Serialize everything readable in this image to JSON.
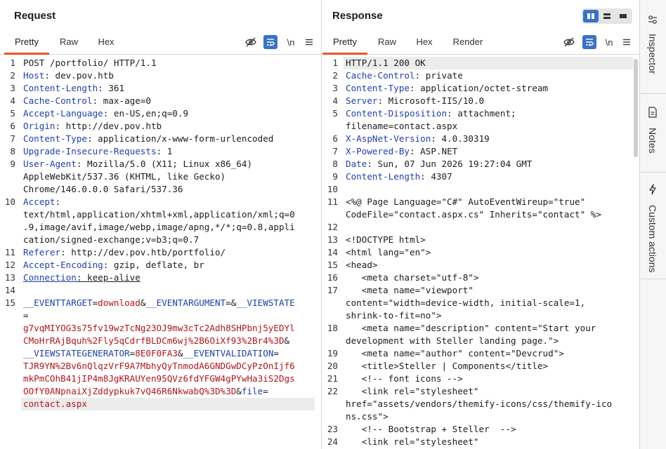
{
  "request": {
    "title": "Request",
    "tabs": [
      "Pretty",
      "Raw",
      "Hex"
    ],
    "active_tab": "Pretty",
    "lines": [
      {
        "n": "1",
        "segs": [
          [
            "t",
            "POST /portfolio/ HTTP/1.1"
          ]
        ]
      },
      {
        "n": "2",
        "segs": [
          [
            "k",
            "Host"
          ],
          [
            "t",
            ": dev.pov.htb"
          ]
        ]
      },
      {
        "n": "3",
        "segs": [
          [
            "k",
            "Content-Length"
          ],
          [
            "t",
            ": 361"
          ]
        ]
      },
      {
        "n": "4",
        "segs": [
          [
            "k",
            "Cache-Control"
          ],
          [
            "t",
            ": max-age=0"
          ]
        ]
      },
      {
        "n": "5",
        "segs": [
          [
            "k",
            "Accept-Language"
          ],
          [
            "t",
            ": en-US,en;q=0.9"
          ]
        ]
      },
      {
        "n": "6",
        "segs": [
          [
            "k",
            "Origin"
          ],
          [
            "t",
            ": http://dev.pov.htb"
          ]
        ]
      },
      {
        "n": "7",
        "segs": [
          [
            "k",
            "Content-Type"
          ],
          [
            "t",
            ": application/x-www-form-urlencoded"
          ]
        ]
      },
      {
        "n": "8",
        "segs": [
          [
            "k",
            "Upgrade-Insecure-Requests"
          ],
          [
            "t",
            ": 1"
          ]
        ]
      },
      {
        "n": "9",
        "segs": [
          [
            "k",
            "User-Agent"
          ],
          [
            "t",
            ": Mozilla/5.0 (X11; Linux x86_64)"
          ]
        ]
      },
      {
        "n": "",
        "segs": [
          [
            "t",
            "AppleWebKit/537.36 (KHTML, like Gecko)"
          ]
        ]
      },
      {
        "n": "",
        "segs": [
          [
            "t",
            "Chrome/146.0.0.0 Safari/537.36"
          ]
        ]
      },
      {
        "n": "10",
        "segs": [
          [
            "k",
            "Accept"
          ],
          [
            "t",
            ":"
          ]
        ]
      },
      {
        "n": "",
        "segs": [
          [
            "t",
            "text/html,application/xhtml+xml,application/xml;q=0"
          ]
        ]
      },
      {
        "n": "",
        "segs": [
          [
            "t",
            ".9,image/avif,image/webp,image/apng,*/*;q=0.8,appli"
          ]
        ]
      },
      {
        "n": "",
        "segs": [
          [
            "t",
            "cation/signed-exchange;v=b3;q=0.7"
          ]
        ]
      },
      {
        "n": "11",
        "segs": [
          [
            "k",
            "Referer"
          ],
          [
            "t",
            ": http://dev.pov.htb/portfolio/"
          ]
        ]
      },
      {
        "n": "12",
        "segs": [
          [
            "k",
            "Accept-Encoding"
          ],
          [
            "t",
            ": gzip, deflate, br"
          ]
        ]
      },
      {
        "n": "13",
        "segs": [
          [
            "k",
            "Connection"
          ],
          [
            "t",
            ": keep-alive"
          ]
        ]
      },
      {
        "n": "14",
        "segs": []
      },
      {
        "n": "15",
        "segs": [
          [
            "p",
            "__EVENTTARGET"
          ],
          [
            "t",
            "="
          ],
          [
            "v",
            "download"
          ],
          [
            "t",
            "&"
          ],
          [
            "p",
            "__EVENTARGUMENT"
          ],
          [
            "t",
            "=&"
          ],
          [
            "p",
            "__VIEWSTATE"
          ]
        ]
      },
      {
        "n": "",
        "segs": [
          [
            "t",
            "="
          ]
        ]
      },
      {
        "n": "",
        "segs": [
          [
            "v",
            "g7vqMIYOG3s75fv19wzTcNg23OJ9mw3cTc2Adh8SHPbnj5yEDYl"
          ]
        ]
      },
      {
        "n": "",
        "segs": [
          [
            "v",
            "CMoHrRAjBquh%2Fly5qCdrfBLDCm6wj%2B6OiXf93%2Br4%3D"
          ],
          [
            "t",
            "&"
          ]
        ]
      },
      {
        "n": "",
        "segs": [
          [
            "p",
            "__VIEWSTATEGENERATOR"
          ],
          [
            "t",
            "="
          ],
          [
            "v",
            "8E0F0FA3"
          ],
          [
            "t",
            "&"
          ],
          [
            "p",
            "__EVENTVALIDATION"
          ],
          [
            "t",
            "="
          ]
        ]
      },
      {
        "n": "",
        "segs": [
          [
            "v",
            "TJR9YN%2Bv6nQlqzVrF9A7MbhyQyTnmodA6GNDGwDCyPzOnIjf6"
          ]
        ]
      },
      {
        "n": "",
        "segs": [
          [
            "v",
            "mkPmCOhB41jIP4m8JgKRAUYen95QVz6fdYFGW4gPYwHa3iS2Dgs"
          ]
        ]
      },
      {
        "n": "",
        "segs": [
          [
            "v",
            "OOfY0ANpnaiXjZddypkuk7vQ46R6NkwabQ%3D%3D"
          ],
          [
            "t",
            "&"
          ],
          [
            "p",
            "file"
          ],
          [
            "t",
            "="
          ]
        ]
      },
      {
        "n": "",
        "segs": [
          [
            "v",
            "contact.aspx"
          ]
        ]
      }
    ]
  },
  "response": {
    "title": "Response",
    "tabs": [
      "Pretty",
      "Raw",
      "Hex",
      "Render"
    ],
    "active_tab": "Pretty",
    "lines": [
      {
        "n": "1",
        "segs": [
          [
            "t",
            "HTTP/1.1 200 OK"
          ]
        ]
      },
      {
        "n": "2",
        "segs": [
          [
            "k",
            "Cache-Control"
          ],
          [
            "t",
            ": private"
          ]
        ]
      },
      {
        "n": "3",
        "segs": [
          [
            "k",
            "Content-Type"
          ],
          [
            "t",
            ": application/octet-stream"
          ]
        ]
      },
      {
        "n": "4",
        "segs": [
          [
            "k",
            "Server"
          ],
          [
            "t",
            ": Microsoft-IIS/10.0"
          ]
        ]
      },
      {
        "n": "5",
        "segs": [
          [
            "k",
            "Content-Disposition"
          ],
          [
            "t",
            ": attachment;"
          ]
        ]
      },
      {
        "n": "",
        "segs": [
          [
            "t",
            "filename=contact.aspx"
          ]
        ]
      },
      {
        "n": "6",
        "segs": [
          [
            "k",
            "X-AspNet-Version"
          ],
          [
            "t",
            ": 4.0.30319"
          ]
        ]
      },
      {
        "n": "7",
        "segs": [
          [
            "k",
            "X-Powered-By"
          ],
          [
            "t",
            ": ASP.NET"
          ]
        ]
      },
      {
        "n": "8",
        "segs": [
          [
            "k",
            "Date"
          ],
          [
            "t",
            ": Sun, 07 Jun 2026 19:27:04 GMT"
          ]
        ]
      },
      {
        "n": "9",
        "segs": [
          [
            "k",
            "Content-Length"
          ],
          [
            "t",
            ": 4307"
          ]
        ]
      },
      {
        "n": "10",
        "segs": []
      },
      {
        "n": "11",
        "segs": [
          [
            "t",
            "<%@ Page Language=\"C#\" AutoEventWireup=\"true\""
          ]
        ]
      },
      {
        "n": "",
        "segs": [
          [
            "t",
            "CodeFile=\"contact.aspx.cs\" Inherits=\"contact\" %>"
          ]
        ]
      },
      {
        "n": "12",
        "segs": []
      },
      {
        "n": "13",
        "segs": [
          [
            "t",
            "<!DOCTYPE html>"
          ]
        ]
      },
      {
        "n": "14",
        "segs": [
          [
            "t",
            "<html lang=\"en\">"
          ]
        ]
      },
      {
        "n": "15",
        "segs": [
          [
            "t",
            "<head>"
          ]
        ]
      },
      {
        "n": "16",
        "segs": [
          [
            "t",
            "   <meta charset=\"utf-8\">"
          ]
        ]
      },
      {
        "n": "17",
        "segs": [
          [
            "t",
            "   <meta name=\"viewport\""
          ]
        ]
      },
      {
        "n": "",
        "segs": [
          [
            "t",
            "content=\"width=device-width, initial-scale=1,"
          ]
        ]
      },
      {
        "n": "",
        "segs": [
          [
            "t",
            "shrink-to-fit=no\">"
          ]
        ]
      },
      {
        "n": "18",
        "segs": [
          [
            "t",
            "   <meta name=\"description\" content=\"Start your"
          ]
        ]
      },
      {
        "n": "",
        "segs": [
          [
            "t",
            "development with Steller landing page.\">"
          ]
        ]
      },
      {
        "n": "19",
        "segs": [
          [
            "t",
            "   <meta name=\"author\" content=\"Devcrud\">"
          ]
        ]
      },
      {
        "n": "20",
        "segs": [
          [
            "t",
            "   <title>Steller | Components</title>"
          ]
        ]
      },
      {
        "n": "21",
        "segs": [
          [
            "t",
            "   <!-- font icons -->"
          ]
        ]
      },
      {
        "n": "22",
        "segs": [
          [
            "t",
            "   <link rel=\"stylesheet\""
          ]
        ]
      },
      {
        "n": "",
        "segs": [
          [
            "t",
            "href=\"assets/vendors/themify-icons/css/themify-ico"
          ]
        ]
      },
      {
        "n": "",
        "segs": [
          [
            "t",
            "ns.css\">"
          ]
        ]
      },
      {
        "n": "23",
        "segs": [
          [
            "t",
            "   <!-- Bootstrap + Steller  -->"
          ]
        ]
      },
      {
        "n": "24",
        "segs": [
          [
            "t",
            "   <link rel=\"stylesheet\""
          ]
        ]
      }
    ]
  },
  "toolbar": {
    "newline_label": "\\n"
  },
  "sidebar": {
    "items": [
      {
        "label": "Inspector",
        "icon": "inspector-icon"
      },
      {
        "label": "Notes",
        "icon": "notes-icon"
      },
      {
        "label": "Custom actions",
        "icon": "lightning-icon"
      }
    ]
  },
  "colors": {
    "accent": "#e8572a",
    "selected": "#3a72c4",
    "header_key": "#1f3fa8",
    "param_value": "#b0161d"
  }
}
